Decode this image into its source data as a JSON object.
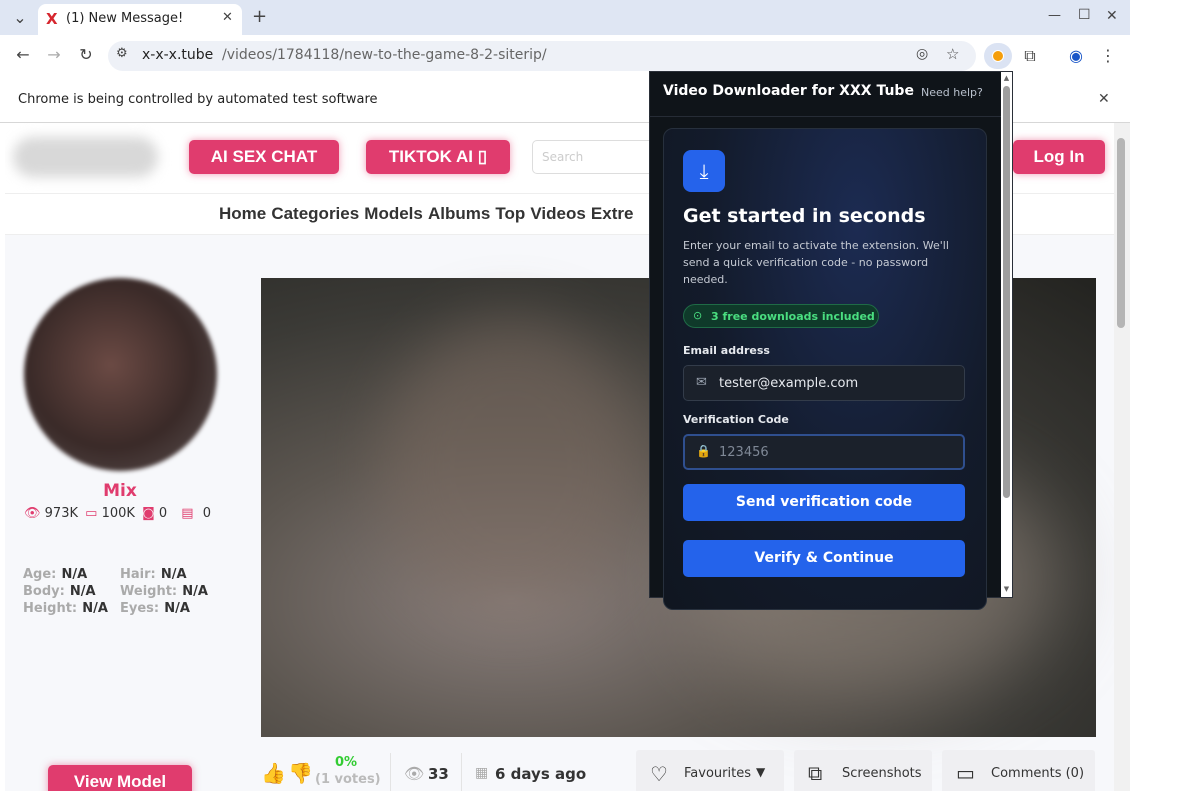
{
  "browser": {
    "tab_title": "(1) New Message!",
    "new_tab": "+",
    "url_host": "x-x-x.tube",
    "url_path": "/videos/1784118/new-to-the-game-8-2-siterip/",
    "infobar_text": "Chrome is being controlled by automated test software",
    "infobar_close": "✕",
    "window_controls": [
      "—",
      "☐",
      "✕"
    ]
  },
  "site": {
    "header": {
      "ai_sex_chat": "AI SEX CHAT",
      "tiktok_ai": "TIKTOK AI ▯",
      "search_placeholder": "Search",
      "login": "Log In"
    },
    "nav": [
      "Home",
      "Categories",
      "Models",
      "Albums",
      "Top",
      "Videos",
      "Extre"
    ],
    "model": {
      "name": "Mix",
      "views": "973K",
      "videos": "100K",
      "photos": "0",
      "docs": "0",
      "attributes": [
        {
          "label": "Age:",
          "value": "N/A"
        },
        {
          "label": "Hair:",
          "value": "N/A"
        },
        {
          "label": "Body:",
          "value": "N/A"
        },
        {
          "label": "Weight:",
          "value": "N/A"
        },
        {
          "label": "Height:",
          "value": "N/A"
        },
        {
          "label": "Eyes:",
          "value": "N/A"
        }
      ],
      "view_button": "View Model"
    },
    "video_stats": {
      "rating": "0%",
      "votes": "(1 votes)",
      "views": "33",
      "age": "6 days ago",
      "favourites": "Favourites",
      "screenshots": "Screenshots",
      "comments": "Comments (0)"
    }
  },
  "extension": {
    "title": "Video Downloader for XXX Tube",
    "help": "Need help?",
    "heading": "Get started in seconds",
    "description": "Enter your email to activate the extension. We'll send a quick verification code - no password needed.",
    "badge": "3 free downloads included",
    "email_label": "Email address",
    "email_value": "tester@example.com",
    "code_label": "Verification Code",
    "code_placeholder": "123456",
    "send_button": "Send verification code",
    "verify_button": "Verify & Continue"
  },
  "colors": {
    "accent_pink": "#e03c6e",
    "blue_button": "#2463eb",
    "badge_green": "#4ade80",
    "popup_bg": "#0f1419"
  }
}
